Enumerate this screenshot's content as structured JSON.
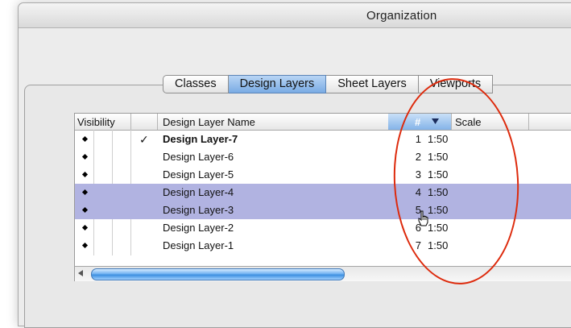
{
  "window": {
    "title": "Organization"
  },
  "tabs": [
    {
      "label": "Classes",
      "active": false
    },
    {
      "label": "Design Layers",
      "active": true
    },
    {
      "label": "Sheet Layers",
      "active": false
    },
    {
      "label": "Viewports",
      "active": false
    }
  ],
  "table": {
    "columns": {
      "visibility": "Visibility",
      "name": "Design Layer Name",
      "number": "#",
      "scale": "Scale"
    },
    "sort_indicator": "descending",
    "rows": [
      {
        "visible": true,
        "active": true,
        "check": "✓",
        "name": "Design Layer-7",
        "number": "1",
        "scale": "1:50",
        "selected": false
      },
      {
        "visible": true,
        "active": false,
        "check": "",
        "name": "Design Layer-6",
        "number": "2",
        "scale": "1:50",
        "selected": false
      },
      {
        "visible": true,
        "active": false,
        "check": "",
        "name": "Design Layer-5",
        "number": "3",
        "scale": "1:50",
        "selected": false
      },
      {
        "visible": true,
        "active": false,
        "check": "",
        "name": "Design Layer-4",
        "number": "4",
        "scale": "1:50",
        "selected": true
      },
      {
        "visible": true,
        "active": false,
        "check": "",
        "name": "Design Layer-3",
        "number": "5",
        "scale": "1:50",
        "selected": true
      },
      {
        "visible": true,
        "active": false,
        "check": "",
        "name": "Design Layer-2",
        "number": "6",
        "scale": "1:50",
        "selected": false
      },
      {
        "visible": true,
        "active": false,
        "check": "",
        "name": "Design Layer-1",
        "number": "7",
        "scale": "1:50",
        "selected": false
      }
    ]
  },
  "annotation": {
    "shape": "ellipse",
    "color": "#dd2a0c"
  },
  "colors": {
    "selection": "#b1b3e1",
    "active_tab": "#79abe4",
    "scroll_thumb": "#3c8fe0"
  },
  "icons": [
    "diamond-icon",
    "checkmark-icon",
    "sort-descending-icon",
    "scroll-left-arrow-icon",
    "drag-hand-cursor-icon"
  ]
}
